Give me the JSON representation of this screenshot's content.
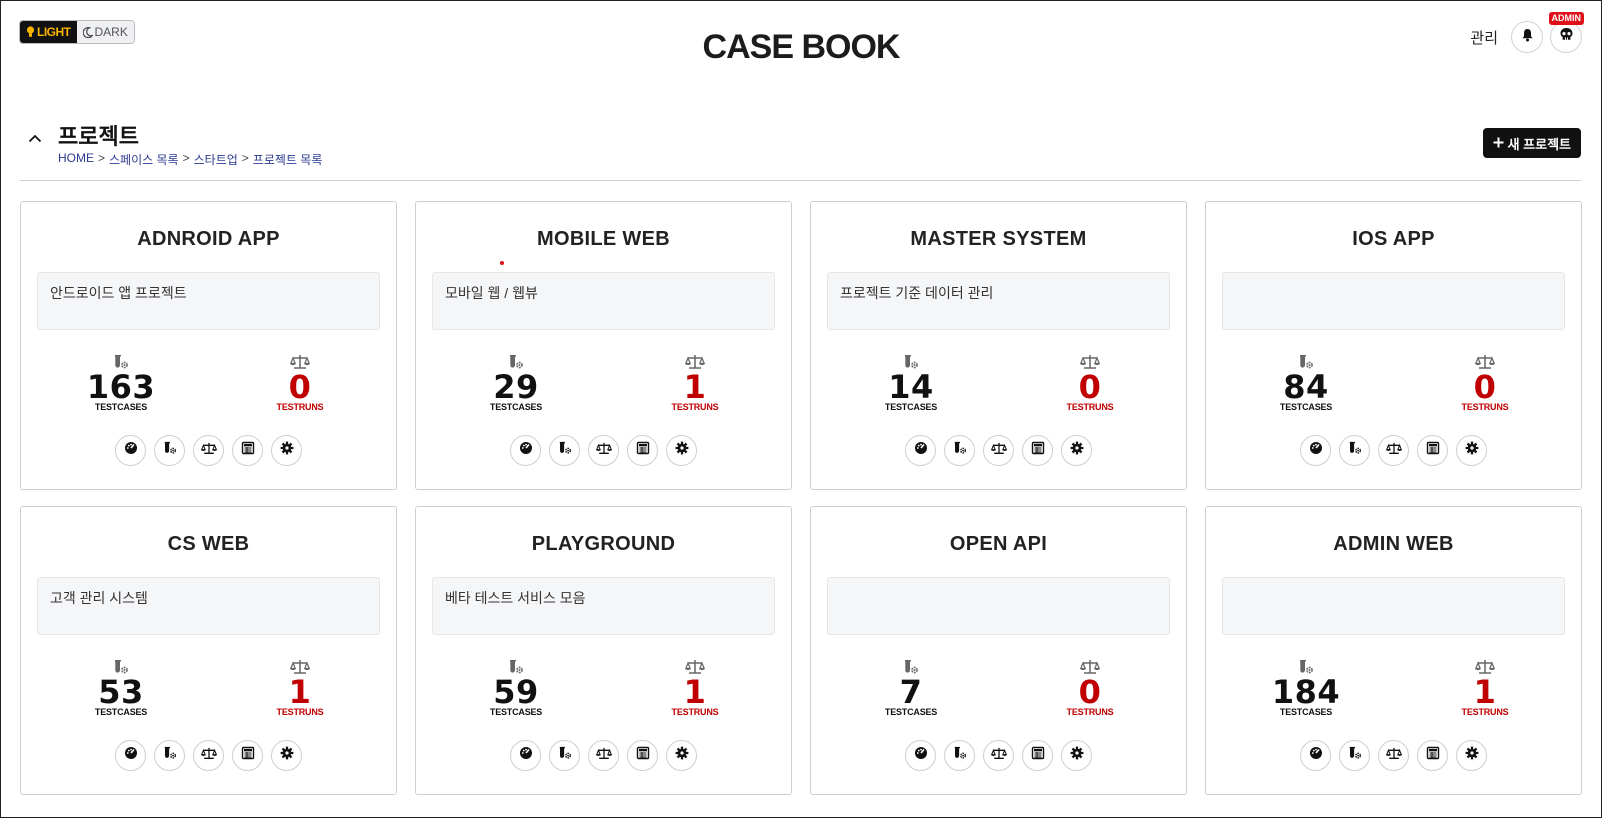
{
  "header": {
    "theme_light_label": "LIGHT",
    "theme_dark_label": "DARK",
    "app_title": "CASE BOOK",
    "admin_link": "관리",
    "admin_badge": "ADMIN"
  },
  "page": {
    "title": "프로젝트",
    "breadcrumb": [
      "HOME",
      "스페이스 목록",
      "스타트업",
      "프로젝트 목록"
    ],
    "breadcrumb_separator": ">",
    "new_project_label": "새 프로젝트"
  },
  "stat_labels": {
    "testcases": "TESTCASES",
    "testruns": "TESTRUNS"
  },
  "colors": {
    "accent": "#f7b500",
    "testruns": "#c00000",
    "badge": "#e0101a",
    "dark": "#111111"
  },
  "card_action_icons": [
    "dashboard-icon",
    "testcase-icon",
    "testrun-icon",
    "report-icon",
    "settings-icon"
  ],
  "projects": [
    {
      "name": "ADNROID APP",
      "description": "안드로이드 앱 프로젝트",
      "testcases": "163",
      "testruns": "0"
    },
    {
      "name": "MOBILE WEB",
      "description": "모바일 웹 / 웹뷰",
      "testcases": "29",
      "testruns": "1"
    },
    {
      "name": "MASTER SYSTEM",
      "description": "프로젝트 기준 데이터 관리",
      "testcases": "14",
      "testruns": "0"
    },
    {
      "name": "IOS APP",
      "description": "",
      "testcases": "84",
      "testruns": "0"
    },
    {
      "name": "CS WEB",
      "description": "고객 관리 시스템",
      "testcases": "53",
      "testruns": "1"
    },
    {
      "name": "PLAYGROUND",
      "description": "베타 테스트 서비스 모음",
      "testcases": "59",
      "testruns": "1"
    },
    {
      "name": "OPEN API",
      "description": "",
      "testcases": "7",
      "testruns": "0"
    },
    {
      "name": "ADMIN WEB",
      "description": "",
      "testcases": "184",
      "testruns": "1"
    }
  ]
}
